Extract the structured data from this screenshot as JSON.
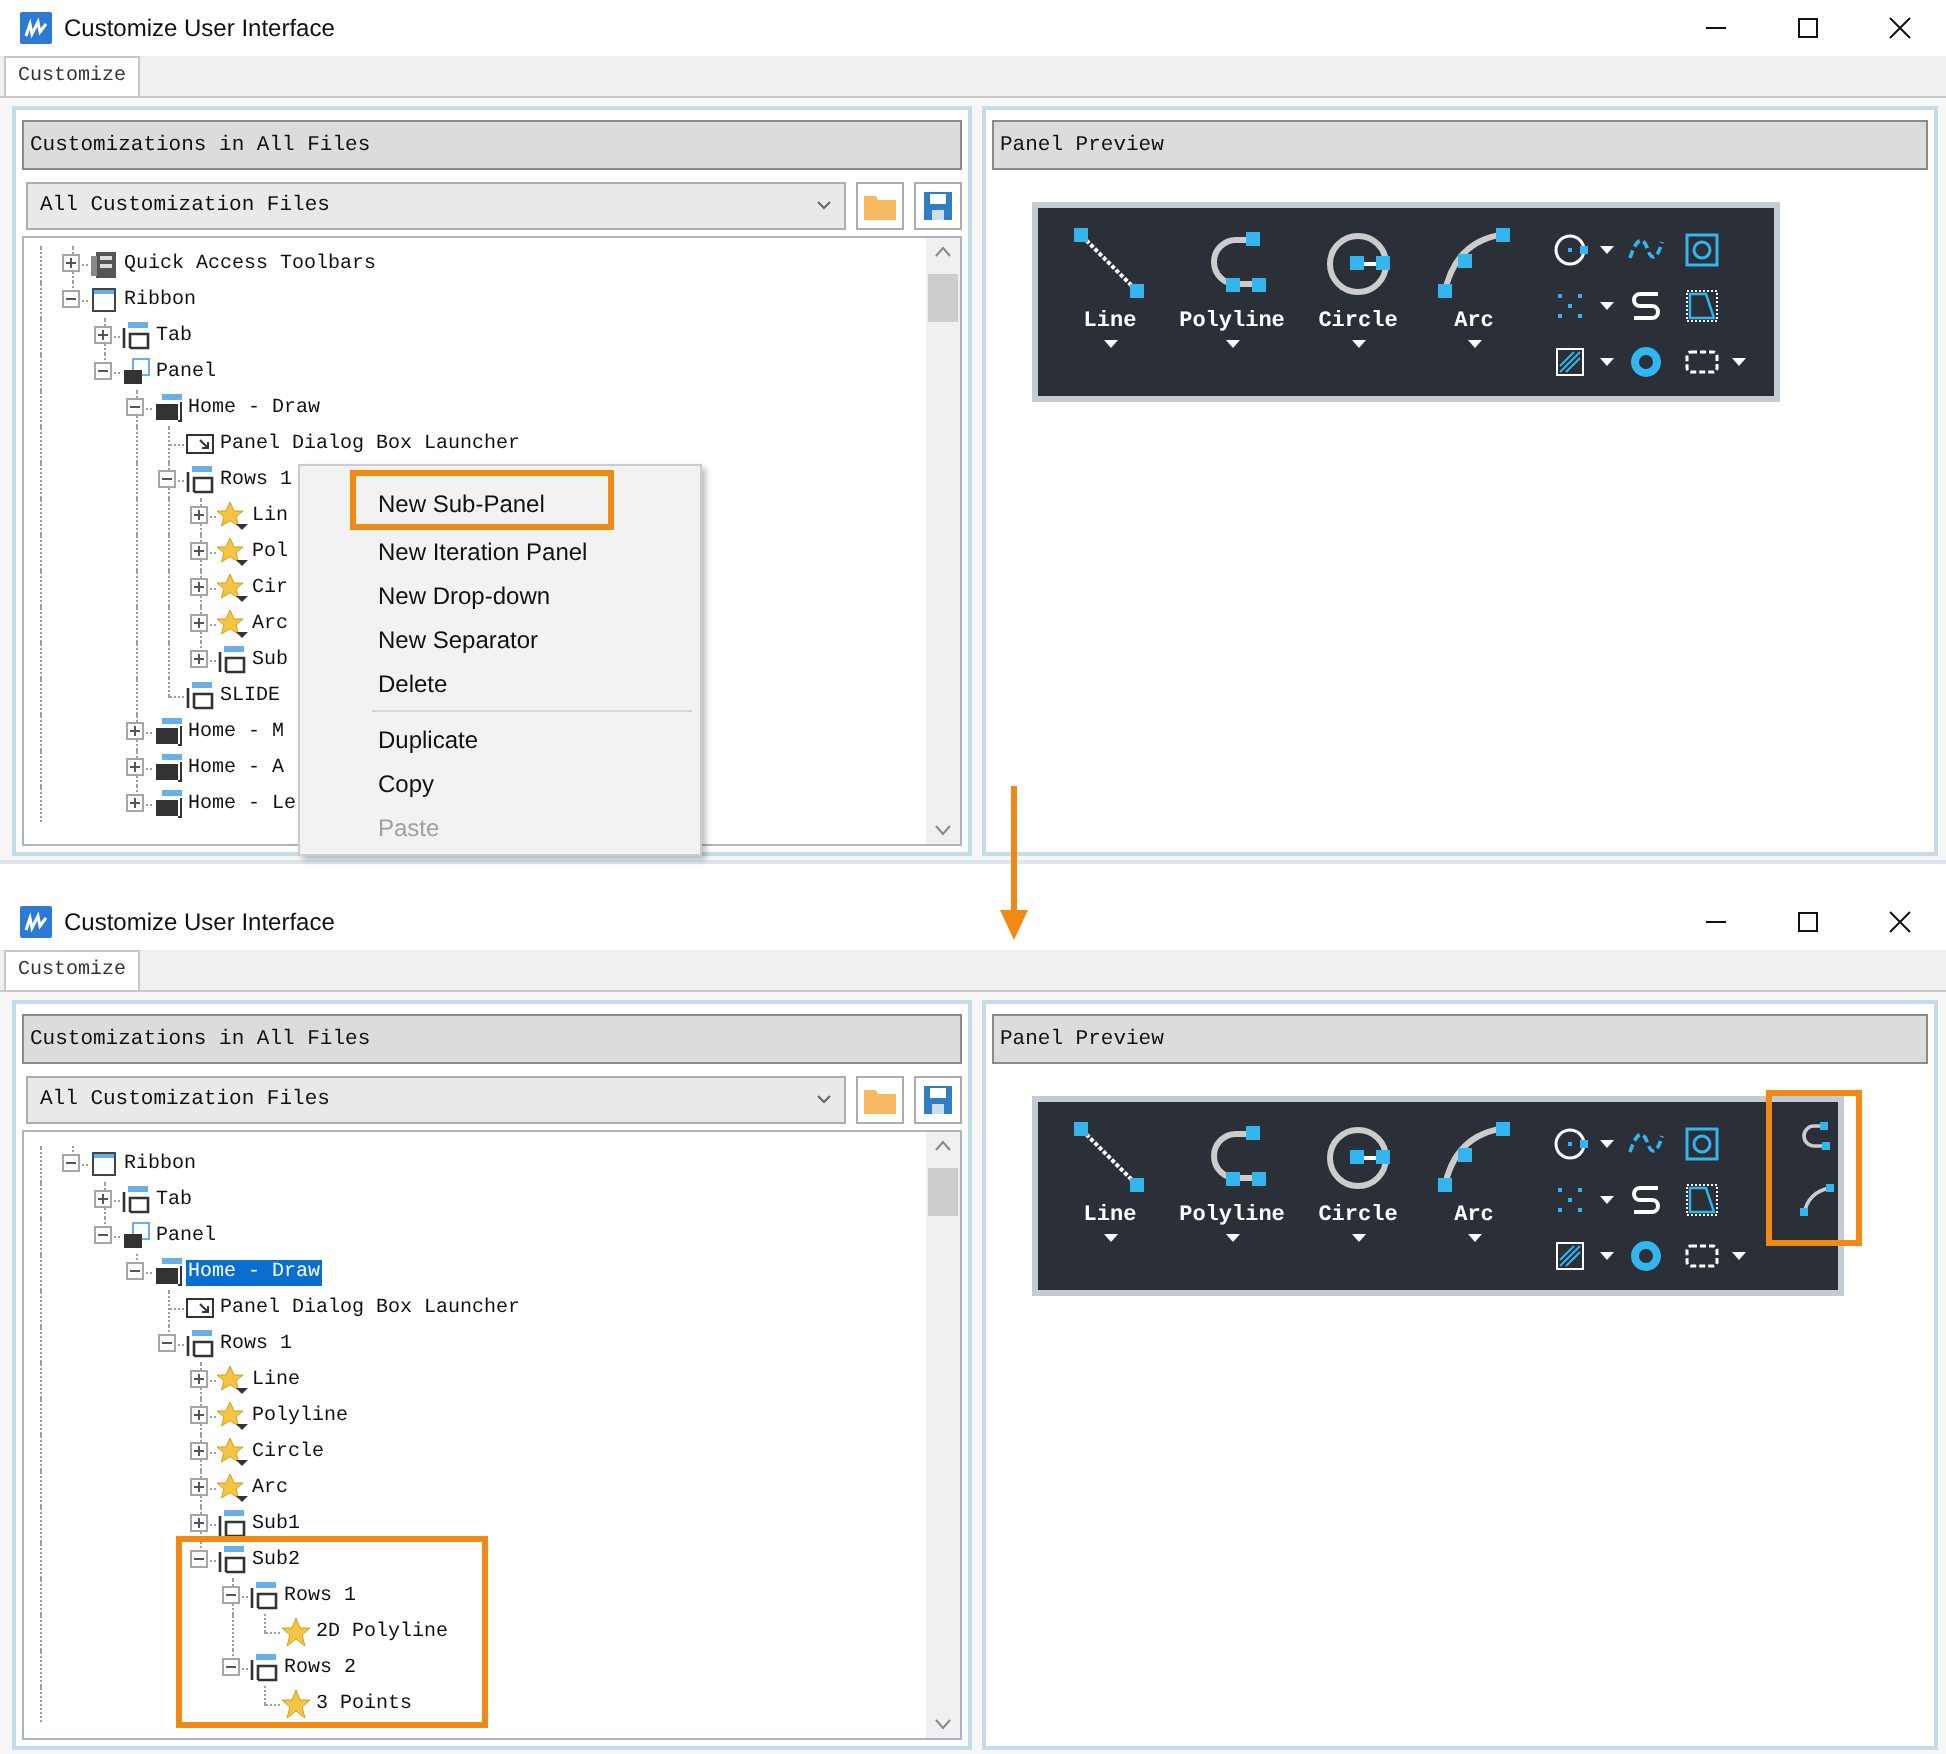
{
  "windows": [
    {
      "title": "Customize User Interface",
      "tabs": [
        {
          "label": "Customize",
          "selected": true
        }
      ],
      "customizations": {
        "header": "Customizations in All Files",
        "file_filter": "All Customization Files",
        "tree": [
          {
            "label": "Quick Access Toolbars",
            "kind": "toolbars",
            "expanded": false,
            "selected": false
          },
          {
            "label": "Ribbon",
            "kind": "ribbon",
            "expanded": true,
            "selected": false,
            "children": [
              {
                "label": "Tab",
                "kind": "rows",
                "expanded": false,
                "selected": false
              },
              {
                "label": "Panel",
                "kind": "panels",
                "expanded": true,
                "selected": false,
                "children": [
                  {
                    "label": "Home - Draw",
                    "kind": "panel",
                    "expanded": true,
                    "selected": false,
                    "children": [
                      {
                        "label": "Panel Dialog Box Launcher",
                        "kind": "launcher",
                        "selected": false
                      },
                      {
                        "label": "Rows 1",
                        "kind": "rows",
                        "expanded": true,
                        "selected": false,
                        "children": [
                          {
                            "label": "Lin",
                            "kind": "command",
                            "expanded": false,
                            "selected": false
                          },
                          {
                            "label": "Pol",
                            "kind": "command",
                            "expanded": false,
                            "selected": false
                          },
                          {
                            "label": "Cir",
                            "kind": "command",
                            "expanded": false,
                            "selected": false
                          },
                          {
                            "label": "Arc",
                            "kind": "command",
                            "expanded": false,
                            "selected": false
                          },
                          {
                            "label": "Sub",
                            "kind": "rows",
                            "expanded": false,
                            "selected": false
                          }
                        ]
                      },
                      {
                        "label": "SLIDE",
                        "kind": "rows",
                        "selected": false
                      }
                    ]
                  },
                  {
                    "label": "Home - M",
                    "kind": "panel",
                    "expanded": false,
                    "selected": false
                  },
                  {
                    "label": "Home - A",
                    "kind": "panel",
                    "expanded": false,
                    "selected": false
                  },
                  {
                    "label": "Home - Le",
                    "kind": "panel",
                    "expanded": false,
                    "selected": false
                  }
                ]
              }
            ]
          }
        ]
      },
      "context_menu": {
        "items": [
          {
            "kind": "item",
            "label": "New Sub-Panel",
            "disabled": false,
            "annotated": true
          },
          {
            "kind": "item",
            "label": "New Iteration Panel",
            "disabled": false,
            "annotated": false
          },
          {
            "kind": "item",
            "label": "New Drop-down",
            "disabled": false,
            "annotated": false
          },
          {
            "kind": "item",
            "label": "New Separator",
            "disabled": false,
            "annotated": false
          },
          {
            "kind": "item",
            "label": "Delete",
            "disabled": false,
            "annotated": false
          },
          {
            "kind": "separator"
          },
          {
            "kind": "item",
            "label": "Duplicate",
            "disabled": false,
            "annotated": false
          },
          {
            "kind": "item",
            "label": "Copy",
            "disabled": false,
            "annotated": false
          },
          {
            "kind": "item",
            "label": "Paste",
            "disabled": true,
            "annotated": false
          }
        ]
      },
      "preview": {
        "header": "Panel Preview",
        "large_tools": [
          {
            "label": "Line",
            "kind": "line"
          },
          {
            "label": "Polyline",
            "kind": "polyline"
          },
          {
            "label": "Circle",
            "kind": "circle"
          },
          {
            "label": "Arc",
            "kind": "arc"
          }
        ],
        "small_tools": [
          {
            "kind": "center-circle",
            "dropdown": true
          },
          {
            "kind": "spline",
            "dropdown": false
          },
          {
            "kind": "boundary",
            "dropdown": false
          },
          {
            "kind": "points",
            "dropdown": true
          },
          {
            "kind": "helix",
            "dropdown": false
          },
          {
            "kind": "region",
            "dropdown": false
          },
          {
            "kind": "hatch",
            "dropdown": true
          },
          {
            "kind": "donut",
            "dropdown": false
          },
          {
            "kind": "revcloud",
            "dropdown": true
          }
        ]
      }
    },
    {
      "title": "Customize User Interface",
      "tabs": [
        {
          "label": "Customize",
          "selected": true
        }
      ],
      "customizations": {
        "header": "Customizations in All Files",
        "file_filter": "All Customization Files",
        "tree": [
          {
            "label": "Ribbon",
            "kind": "ribbon",
            "expanded": true,
            "selected": false,
            "children": [
              {
                "label": "Tab",
                "kind": "rows",
                "expanded": false,
                "selected": false
              },
              {
                "label": "Panel",
                "kind": "panels",
                "expanded": true,
                "selected": false,
                "children": [
                  {
                    "label": "Home - Draw",
                    "kind": "panel",
                    "expanded": true,
                    "selected": true,
                    "children": [
                      {
                        "label": "Panel Dialog Box Launcher",
                        "kind": "launcher",
                        "selected": false
                      },
                      {
                        "label": "Rows 1",
                        "kind": "rows",
                        "expanded": true,
                        "selected": false,
                        "children": [
                          {
                            "label": "Line",
                            "kind": "command",
                            "expanded": false,
                            "selected": false
                          },
                          {
                            "label": "Polyline",
                            "kind": "command",
                            "expanded": false,
                            "selected": false
                          },
                          {
                            "label": "Circle",
                            "kind": "command",
                            "expanded": false,
                            "selected": false
                          },
                          {
                            "label": "Arc",
                            "kind": "command",
                            "expanded": false,
                            "selected": false
                          },
                          {
                            "label": "Sub1",
                            "kind": "rows",
                            "expanded": false,
                            "selected": false
                          },
                          {
                            "label": "Sub2",
                            "kind": "rows",
                            "expanded": true,
                            "selected": false,
                            "annotated": true,
                            "children": [
                              {
                                "label": "Rows 1",
                                "kind": "rows",
                                "expanded": true,
                                "selected": false,
                                "children": [
                                  {
                                    "label": "2D Polyline",
                                    "kind": "command-star",
                                    "selected": false
                                  }
                                ]
                              },
                              {
                                "label": "Rows 2",
                                "kind": "rows",
                                "expanded": true,
                                "selected": false,
                                "children": [
                                  {
                                    "label": "3 Points",
                                    "kind": "command-star",
                                    "selected": false
                                  }
                                ]
                              }
                            ]
                          }
                        ]
                      }
                    ]
                  }
                ]
              }
            ]
          }
        ]
      },
      "preview": {
        "header": "Panel Preview",
        "large_tools": [
          {
            "label": "Line",
            "kind": "line"
          },
          {
            "label": "Polyline",
            "kind": "polyline"
          },
          {
            "label": "Circle",
            "kind": "circle"
          },
          {
            "label": "Arc",
            "kind": "arc"
          }
        ],
        "small_tools": [
          {
            "kind": "center-circle",
            "dropdown": true
          },
          {
            "kind": "spline",
            "dropdown": false
          },
          {
            "kind": "boundary",
            "dropdown": false
          },
          {
            "kind": "points",
            "dropdown": true
          },
          {
            "kind": "helix",
            "dropdown": false
          },
          {
            "kind": "region",
            "dropdown": false
          },
          {
            "kind": "hatch",
            "dropdown": true
          },
          {
            "kind": "donut",
            "dropdown": false
          },
          {
            "kind": "revcloud",
            "dropdown": true
          }
        ],
        "sub_panel": {
          "annotated": true,
          "tools": [
            {
              "kind": "sub-polyline"
            },
            {
              "kind": "sub-arc"
            }
          ]
        }
      }
    }
  ]
}
